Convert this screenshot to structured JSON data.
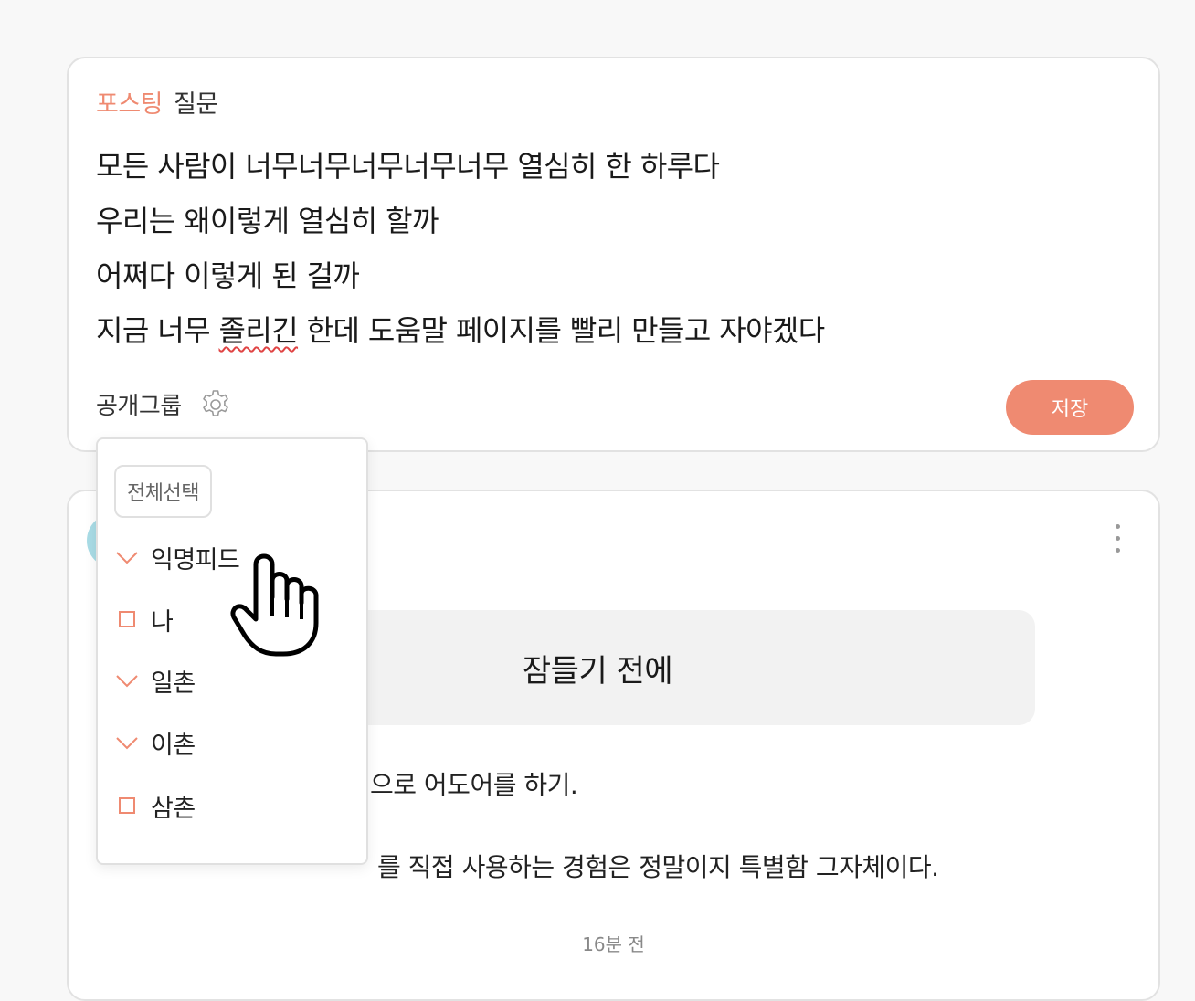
{
  "compose": {
    "header_kind": "포스팅",
    "header_type": "질문",
    "lines": [
      "모든 사람이 너무너무너무너무너무 열심히 한 하루다",
      "우리는 왜이렇게 열심히 할까",
      "어쩌다 이렇게 된 걸까"
    ],
    "line4_before": "지금 너무 ",
    "line4_misspelled": "졸리긴",
    "line4_after": " 한데 도움말 페이지를 빨리 만들고 자야겠다",
    "group_label": "공개그룹",
    "save_label": "저장"
  },
  "dropdown": {
    "select_all_label": "전체선택",
    "options": [
      {
        "label": "익명피드",
        "checked": true
      },
      {
        "label": "나",
        "checked": false
      },
      {
        "label": "일촌",
        "checked": true
      },
      {
        "label": "이촌",
        "checked": true
      },
      {
        "label": "삼촌",
        "checked": false
      }
    ]
  },
  "feed": {
    "title": "잠들기 전에",
    "line1_visible": "으로 어도어를 하기.",
    "line2_visible": "를 직접 사용하는 경험은 정말이지 특별함 그자체이다.",
    "timestamp": "16분 전"
  },
  "colors": {
    "accent": "#ef8a71",
    "background": "#f8f8f8",
    "card": "#ffffff",
    "title_box": "#f2f2f2",
    "avatar": "#a9dce6"
  },
  "icons": {
    "gear": "gear-icon",
    "more": "more-vertical-icon",
    "check": "check-icon",
    "cursor": "pointer-hand-icon"
  }
}
